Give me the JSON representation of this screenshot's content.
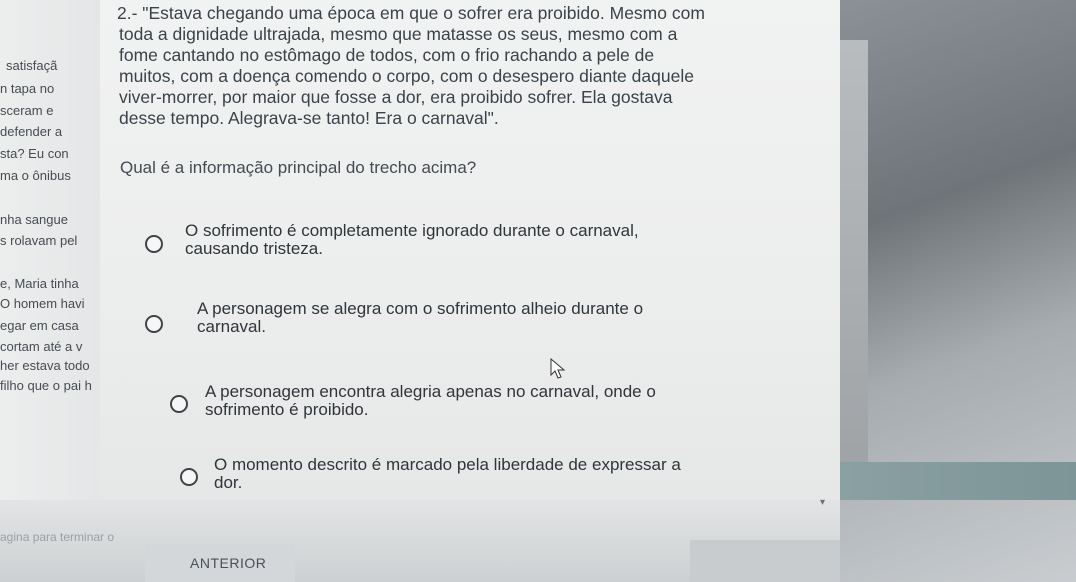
{
  "left_strip": {
    "lines": [
      "satisfaçã",
      "n tapa no",
      "sceram e",
      "defender a",
      "sta? Eu con",
      "ma o ônibus",
      "nha sangue",
      "s rolavam pel",
      "e, Maria tinha",
      "O homem havi",
      "egar em casa",
      "cortam até a v",
      "her estava todo",
      "filho que o pai h"
    ]
  },
  "question": {
    "lines": [
      "2.- \"Estava chegando uma época em que o sofrer era proibido. Mesmo com",
      "toda a dignidade ultrajada, mesmo que matasse os seus, mesmo com a",
      "fome cantando no estômago de todos, com o frio rachando a pele de",
      "muitos, com a doença comendo o corpo, com o desespero diante daquele",
      "viver-morrer, por maior que fosse a dor, era proibido sofrer. Ela gostava",
      "desse tempo. Alegrava-se tanto! Era o carnaval\"."
    ],
    "prompt": "Qual é a informação principal do trecho acima?"
  },
  "options": [
    {
      "text": "O sofrimento é completamente ignorado durante o carnaval,\ncausando tristeza."
    },
    {
      "text": "A personagem se alegra com o sofrimento alheio durante o\ncarnaval."
    },
    {
      "text": "A personagem encontra alegria apenas no carnaval, onde o\nsofrimento é proibido."
    },
    {
      "text": "O momento descrito é marcado pela liberdade de expressar a\ndor."
    }
  ],
  "footer": {
    "hint": "agina para terminar o",
    "prev_label": "ANTERIOR"
  }
}
